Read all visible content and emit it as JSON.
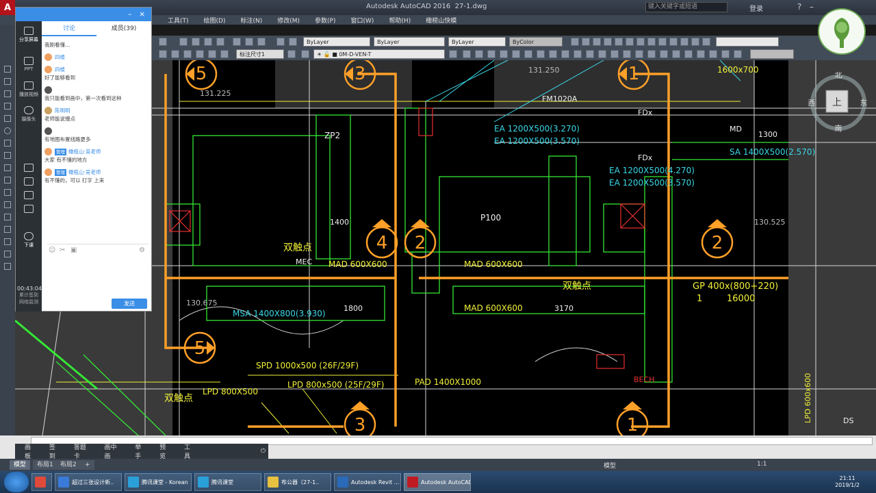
{
  "window": {
    "app_title": "Autodesk AutoCAD 2016",
    "file_name": "27-1.dwg",
    "search_placeholder": "键入关键字或短语",
    "login_label": "登录"
  },
  "menu": {
    "items": [
      "工具(T)",
      "绘图(D)",
      "标注(N)",
      "修改(M)",
      "参数(P)",
      "窗口(W)",
      "帮助(H)",
      "橄榄山快模"
    ]
  },
  "toolbar": {
    "layer_combo": "ByLayer",
    "linetype_combo": "ByLayer",
    "lineweight_combo": "ByLayer",
    "color_combo": "ByColor",
    "dimstyle_combo": "标注尺寸1",
    "current_layer": "0M-D-VEN-T"
  },
  "chat": {
    "tabs": [
      "讨论",
      "成员(39)"
    ],
    "side": [
      "分享屏幕",
      "PPT",
      "播放视频",
      "摄像头",
      "下课"
    ],
    "timer": "00:43:04",
    "timer_labels": [
      "累计签到",
      "网络监测"
    ],
    "send_label": "发送",
    "messages": [
      {
        "who": "",
        "badge": "",
        "text": "我刚看懂…"
      },
      {
        "who": "四楼",
        "badge": "",
        "text": ""
      },
      {
        "who": "四楼",
        "badge": "",
        "text": "好了能够看到"
      },
      {
        "who": "",
        "badge": "",
        "text": "我只能看到画中，第一次看到这种"
      },
      {
        "who": "陈明明",
        "badge": "",
        "text": "老师能说慢点"
      },
      {
        "who": "",
        "badge": "",
        "text": "有地图布置线路更多"
      },
      {
        "who": "橄榄山·吴老师",
        "badge": "管理",
        "text": "大家 有不懂的地方"
      },
      {
        "who": "橄榄山·吴老师",
        "badge": "管理",
        "text": "有不懂的，可以 打字 上来"
      }
    ]
  },
  "drawing": {
    "labels": {
      "ea1": "EA 1200X500(3.270)",
      "ea2": "EA 1200X500(3.570)",
      "ea3": "EA 1200X500(4.270)",
      "ea4": "EA 1200X500(3.570)",
      "sa": "SA 1400X500(2.570)",
      "mad1": "MAD 600X600",
      "mad2": "MAD 600X600",
      "mad3": "MAD 600X600",
      "msa": "MSA 1400X800(3.930)",
      "spd": "SPD 1000x500 (26F/29F)",
      "lpd1": "LPD 800x500 (25F/29F)",
      "lpd2": "LPD 800X500",
      "pad": "PAD 1400X1000",
      "gp": "GP 400x(800+220)",
      "gp_qty": "1",
      "gp_val": "16000",
      "double_contact": "双触点",
      "mec": "MEC",
      "md": "MD",
      "fdx": "FDx",
      "fm": "FM1020A",
      "becb": "BECH",
      "top_dim": "1600x700",
      "dim1": "131.250",
      "dim2": "131.225",
      "dim3": "130.675",
      "dim4": "130.525",
      "num_1300": "1300",
      "num_1800": "1800",
      "num_3170": "3170",
      "num_1400": "1400",
      "p100": "P100",
      "zp2": "ZP2",
      "lpd_v": "LPD 600x600",
      "ds": "DS"
    },
    "callouts": [
      "5",
      "3",
      "1",
      "4",
      "2",
      "2",
      "5",
      "3",
      "1"
    ]
  },
  "navcube": {
    "north": "北",
    "west": "西",
    "east": "东",
    "south": "南",
    "face": "上"
  },
  "toolstrip": {
    "items": [
      "画板",
      "签到",
      "答题卡",
      "画中画",
      "举手",
      "预览",
      "工具"
    ]
  },
  "statusbar": {
    "tabs": [
      "模型",
      "布局1",
      "布局2"
    ],
    "model_label": "模型",
    "scale": "1:1"
  },
  "taskbar": {
    "tasks": [
      "超过三张设计新..",
      "腾讯课堂 - Korean",
      "腾讯课堂",
      "布公器（27-1..",
      "Autodesk Revit ...",
      "Autodesk AutoCAD..."
    ],
    "time": "21:11",
    "date": "2019/1/2"
  },
  "colors": {
    "orange": "#ffa028",
    "green": "#34e834",
    "cyan": "#3ad8e8",
    "yellow": "#f2f23a",
    "white": "#f0f0f0",
    "red": "#e83030"
  }
}
